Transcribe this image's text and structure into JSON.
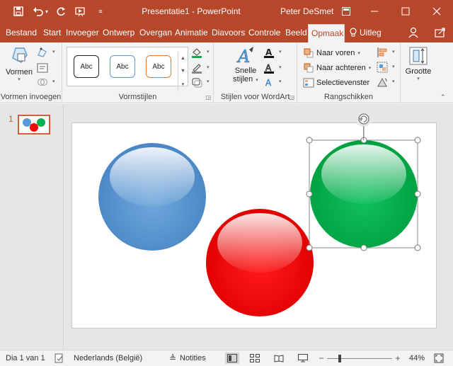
{
  "window": {
    "title": "Presentatie1 - PowerPoint",
    "user": "Peter DeSmet"
  },
  "tabs": [
    {
      "label": "Bestand"
    },
    {
      "label": "Start"
    },
    {
      "label": "Invoeger"
    },
    {
      "label": "Ontwerp"
    },
    {
      "label": "Overgan"
    },
    {
      "label": "Animatie"
    },
    {
      "label": "Diavoorst"
    },
    {
      "label": "Controle"
    },
    {
      "label": "Beeld"
    },
    {
      "label": "Opmaak"
    }
  ],
  "tell_me": "Uitleg",
  "ribbon": {
    "shapes_button": "Vormen",
    "insert_shapes_label": "Vormen invoegen",
    "shape_styles_label": "Vormstijlen",
    "style_sample": "Abc",
    "quick_styles_line1": "Snelle",
    "quick_styles_line2": "stijlen",
    "wordart_label": "Stijlen voor WordArt",
    "bring_forward": "Naar voren",
    "send_backward": "Naar achteren",
    "selection_pane": "Selectievenster",
    "arrange_label": "Rangschikken",
    "size_button": "Grootte"
  },
  "thumbnails": [
    {
      "number": "1"
    }
  ],
  "statusbar": {
    "slide_info": "Dia 1 van 1",
    "language": "Nederlands (België)",
    "notes": "Notities",
    "zoom": "44%"
  },
  "colors": {
    "accent": "#b7472a",
    "blue_circle": "#5b9bd5",
    "red_circle": "#ff0000",
    "green_circle": "#00b050"
  }
}
